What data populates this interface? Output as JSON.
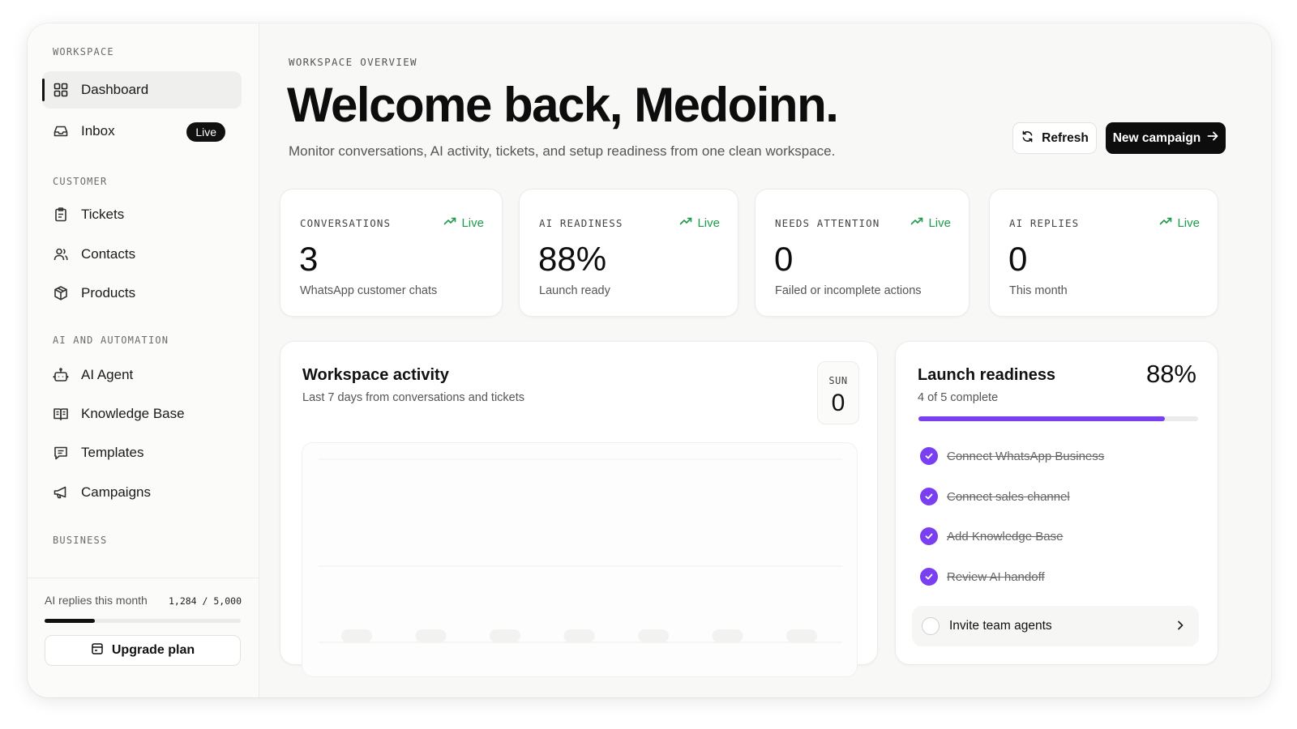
{
  "sidebar": {
    "sections": {
      "workspace": "WORKSPACE",
      "customer": "CUSTOMER",
      "ai": "AI AND AUTOMATION",
      "business": "BUSINESS"
    },
    "items": {
      "dashboard": {
        "label": "Dashboard",
        "icon": "grid-icon"
      },
      "inbox": {
        "label": "Inbox",
        "icon": "inbox-icon",
        "badge": "Live"
      },
      "tickets": {
        "label": "Tickets",
        "icon": "clipboard-icon"
      },
      "contacts": {
        "label": "Contacts",
        "icon": "users-icon"
      },
      "products": {
        "label": "Products",
        "icon": "box-icon"
      },
      "ai_agent": {
        "label": "AI Agent",
        "icon": "bot-icon"
      },
      "knowledge_base": {
        "label": "Knowledge Base",
        "icon": "book-icon"
      },
      "templates": {
        "label": "Templates",
        "icon": "message-icon"
      },
      "campaigns": {
        "label": "Campaigns",
        "icon": "megaphone-icon"
      }
    },
    "usage": {
      "label": "AI replies this month",
      "count": "1,284 / 5,000",
      "progress_fraction": 0.2568,
      "upgrade_label": "Upgrade plan"
    }
  },
  "header": {
    "eyebrow": "WORKSPACE OVERVIEW",
    "title": "Welcome back, Medoinn.",
    "subtitle": "Monitor conversations, AI activity, tickets, and setup readiness from one clean workspace.",
    "refresh_label": "Refresh",
    "new_campaign_label": "New campaign"
  },
  "stats": [
    {
      "label": "CONVERSATIONS",
      "live": "Live",
      "value": "3",
      "caption": "WhatsApp customer chats"
    },
    {
      "label": "AI READINESS",
      "live": "Live",
      "value": "88%",
      "caption": "Launch ready"
    },
    {
      "label": "NEEDS ATTENTION",
      "live": "Live",
      "value": "0",
      "caption": "Failed or incomplete actions"
    },
    {
      "label": "AI REPLIES",
      "live": "Live",
      "value": "0",
      "caption": "This month"
    }
  ],
  "activity": {
    "title": "Workspace activity",
    "subtitle": "Last 7 days from conversations and tickets",
    "day_label": "SUN",
    "day_value": "0",
    "bar_values": [
      0,
      0,
      0,
      0,
      0,
      0,
      0
    ]
  },
  "readiness": {
    "title": "Launch readiness",
    "percent": "88%",
    "progress_fraction": 0.88,
    "summary": "4 of 5 complete",
    "done_items": [
      "Connect WhatsApp Business",
      "Connect sales channel",
      "Add Knowledge Base",
      "Review AI handoff"
    ],
    "todo_item": "Invite team agents"
  },
  "colors": {
    "accent": "#7a3ff0",
    "live_green": "#1c9b4c",
    "primary_dark": "#0d0d0d"
  }
}
